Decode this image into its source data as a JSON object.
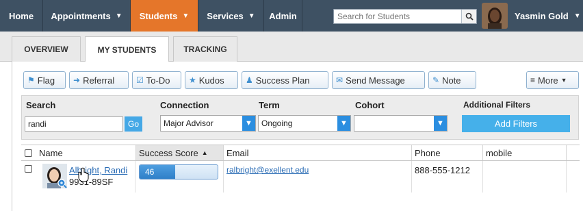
{
  "nav": {
    "home": "Home",
    "appointments": "Appointments",
    "students": "Students",
    "services": "Services",
    "admin": "Admin",
    "search_placeholder": "Search for Students",
    "user_name": "Yasmin Gold"
  },
  "tabs": [
    "OVERVIEW",
    "MY STUDENTS",
    "TRACKING"
  ],
  "actions": {
    "flag": "Flag",
    "referral": "Referral",
    "todo": "To-Do",
    "kudos": "Kudos",
    "success_plan": "Success Plan",
    "send_message": "Send Message",
    "note": "Note",
    "more": "More"
  },
  "filters": {
    "search_label": "Search",
    "search_value": "randi",
    "go": "Go",
    "connection_label": "Connection",
    "connection_value": "Major Advisor",
    "term_label": "Term",
    "term_value": "Ongoing",
    "cohort_label": "Cohort",
    "cohort_value": "",
    "additional_label": "Additional Filters",
    "add_filters": "Add Filters"
  },
  "table": {
    "headers": {
      "name": "Name",
      "success_score": "Success Score",
      "email": "Email",
      "phone": "Phone",
      "mobile": "mobile"
    },
    "rows": [
      {
        "name": "Albright, Randi",
        "id": "9931-89SF",
        "score": 46,
        "score_fraction": 0.46,
        "email": "ralbright@exellent.edu",
        "phone": "888-555-1212",
        "mobile": ""
      }
    ]
  },
  "colors": {
    "nav_bg": "#3e5163",
    "nav_active": "#e5762a",
    "accent_blue": "#45a8e6",
    "link": "#2a6cb5"
  }
}
